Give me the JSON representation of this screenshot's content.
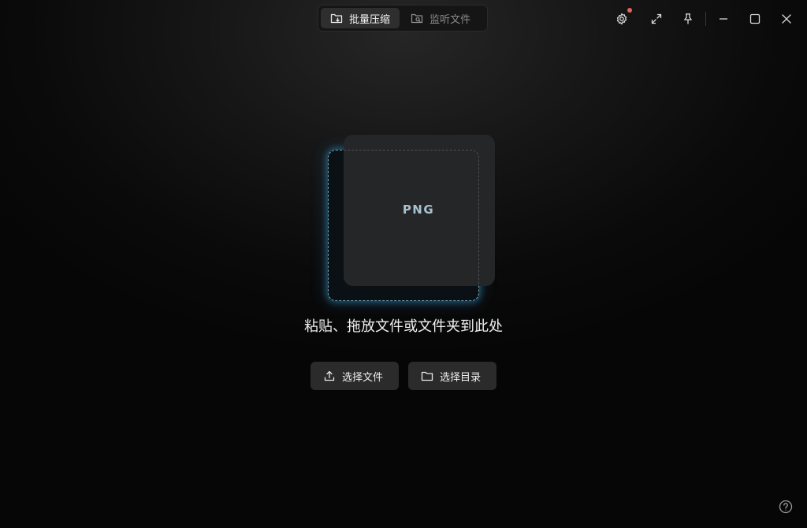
{
  "tabs": [
    {
      "label": "批量压缩",
      "icon": "folder-compress-icon",
      "active": true
    },
    {
      "label": "监听文件",
      "icon": "folder-search-icon",
      "active": false
    }
  ],
  "window_controls": {
    "settings": {
      "icon": "gear-icon",
      "has_notification": true
    },
    "expand": {
      "icon": "expand-icon"
    },
    "pin": {
      "icon": "pin-icon"
    },
    "minimize": {
      "icon": "minimize-icon"
    },
    "maximize": {
      "icon": "maximize-icon"
    },
    "close": {
      "icon": "close-icon"
    }
  },
  "drop": {
    "format_label": "PNG",
    "hint": "粘贴、拖放文件或文件夹到此处"
  },
  "actions": {
    "select_file": "选择文件",
    "select_dir": "选择目录"
  },
  "colors": {
    "accent_glow": "#3a9ccc",
    "notification_dot": "#e8625a",
    "format_text": "#a9c2cf"
  }
}
